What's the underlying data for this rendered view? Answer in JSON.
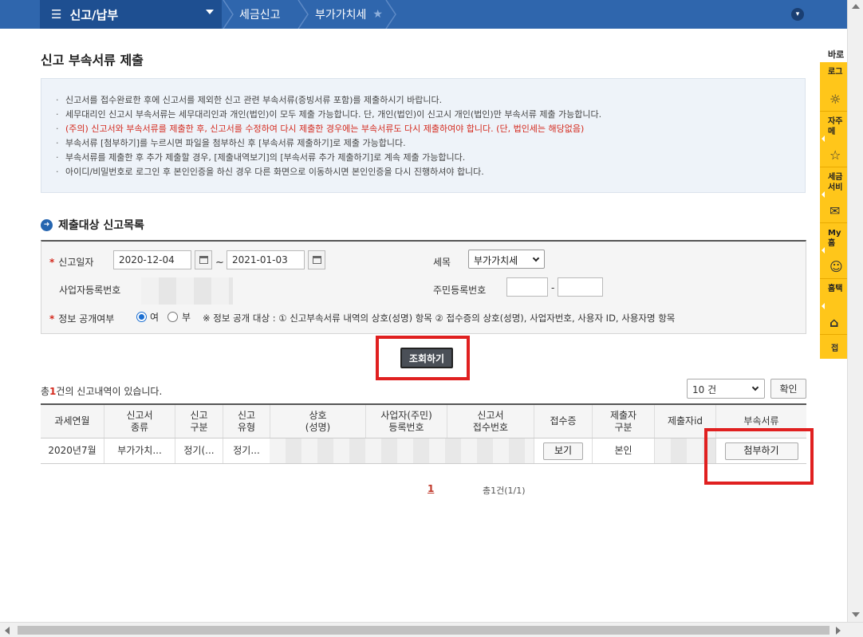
{
  "nav": {
    "menu_label": "신고/납부",
    "breadcrumb": [
      "세금신고",
      "부가가치세"
    ]
  },
  "page_title": "신고 부속서류 제출",
  "notices": [
    {
      "text": "신고서를 접수완료한 후에 신고서를 제외한 신고 관련 부속서류(증빙서류 포함)를 제출하시기 바랍니다.",
      "red": false
    },
    {
      "text": "세무대리인 신고시 부속서류는 세무대리인과 개인(법인)이 모두 제출 가능합니다. 단, 개인(법인)이 신고시 개인(법인)만 부속서류 제출 가능합니다.",
      "red": false
    },
    {
      "text": "(주의) 신고서와 부속서류를 제출한 후, 신고서를 수정하여 다시 제출한 경우에는 부속서류도 다시 제출하여야 합니다. (단, 법인세는 해당없음)",
      "red": true
    },
    {
      "text": "부속서류 [첨부하기]를 누르시면 파일을 첨부하신 후 [부속서류 제출하기]로 제출 가능합니다.",
      "red": false
    },
    {
      "text": "부속서류를 제출한 후 추가 제출할 경우, [제출내역보기]의 [부속서류 추가 제출하기]로 계속 제출 가능합니다.",
      "red": false
    },
    {
      "text": "아이디/비밀번호로 로그인 후 본인인증을 하신 경우 다른 화면으로 이동하시면 본인인증을 다시 진행하셔야 합니다.",
      "red": false
    }
  ],
  "section_title": "제출대상 신고목록",
  "search": {
    "date_label": "신고일자",
    "date_from": "2020-12-04",
    "date_to": "2021-01-03",
    "tilde": "~",
    "tax_label": "세목",
    "tax_value": "부가가치세",
    "biz_reg_label": "사업자등록번호",
    "resident_label": "주민등록번호",
    "resident_dash": "-",
    "disclosure_label": "정보 공개여부",
    "yes_label": "여",
    "no_label": "부",
    "disclosure_note": "※ 정보 공개 대상 : ① 신고부속서류 내역의 상호(성명) 항목 ② 접수증의 상호(성명), 사업자번호, 사용자 ID, 사용자명 항목",
    "search_button": "조회하기",
    "required_mark": "*"
  },
  "results": {
    "count_prefix": "총",
    "count": "1",
    "count_suffix": "건의 신고내역이 있습니다.",
    "page_size": "10 건",
    "confirm_button": "확인",
    "headers": [
      "과세연월",
      "신고서\n종류",
      "신고\n구분",
      "신고\n유형",
      "상호\n(성명)",
      "사업자(주민)\n등록번호",
      "신고서\n접수번호",
      "접수증",
      "제출자\n구분",
      "제출자id",
      "부속서류"
    ],
    "rows": [
      {
        "period": "2020년7월",
        "kind": "부가가치...",
        "division": "정기(...",
        "type": "정기...",
        "receipt_btn": "보기",
        "submitter": "본인",
        "attach_btn": "첨부하기"
      }
    ],
    "page_current": "1",
    "page_info": "총1건(1/1)"
  },
  "quick_menu": {
    "title": "바로",
    "items": [
      "로그",
      "자주\n메",
      "세금\n서비",
      "My 홈",
      "홈택"
    ],
    "last": "접"
  }
}
